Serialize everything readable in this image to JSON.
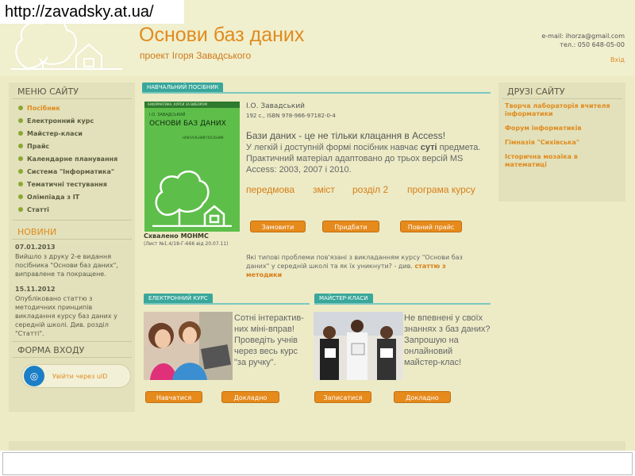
{
  "url": "http://zavadsky.at.ua/",
  "header": {
    "title": "Основи баз даних",
    "subtitle": "проект Ігоря Завадського",
    "email": "e-mail: ihorza@gmail.com",
    "phone": "тел.: 050 648-05-00",
    "login": "Вхід"
  },
  "sidebar": {
    "menu_title": "МЕНЮ САЙТУ",
    "items": [
      {
        "label": "Посібник"
      },
      {
        "label": "Електронний курс"
      },
      {
        "label": "Майстер-класи"
      },
      {
        "label": "Прайс"
      },
      {
        "label": "Календарне планування"
      },
      {
        "label": "Система \"Інформатика\""
      },
      {
        "label": "Тематичні тестування"
      },
      {
        "label": "Олімпіада з ІТ"
      },
      {
        "label": "Статті"
      }
    ],
    "news_title": "НОВИНИ",
    "news": [
      {
        "date": "07.01.2013",
        "text": "Вийшло з друку 2-е видання посібника \"Основи баз даних\", виправлене та покращене."
      },
      {
        "date": "15.11.2012",
        "text": "Опубліковано статтю з методичних принципів викладання курсу баз даних у середній школі. Див. розділ \"Статті\"."
      }
    ],
    "login_title": "ФОРМА ВХОДУ",
    "uid_label": "Увійти через uID"
  },
  "main": {
    "tab_book": "НАВЧАЛЬНИЙ ПОСІБНИК",
    "book": {
      "series": "ІНФОРМАТИКА. КУРСИ ЗА ВИБОРОМ",
      "author_short": "І.О. ЗАВАДСЬКИЙ",
      "title": "ОСНОВИ БАЗ ДАНИХ",
      "kind": "НАВЧАЛЬНИЙ ПОСІБНИК"
    },
    "approved": "Схвалено МОНМС",
    "approved_sub": "(Лист №1.4/18-Г-666 від 20.07.11)",
    "author": "І.О. Завадський",
    "isbn": "192 с., ISBN 978-966-97182-0-4",
    "heading": "Бази даних - це не тільки клацання в Access!",
    "desc_before": "У легкій і доступній формі посібник навчає ",
    "desc_bold": "суті",
    "desc_after": " предмета. Практичний матеріал адаптовано до трьох версій MS Access: 2003, 2007 і 2010.",
    "links": [
      "передмова",
      "зміст",
      "розділ 2",
      "програма курсу"
    ],
    "buttons": [
      "Замовити",
      "Придбати",
      "Повний прайс"
    ],
    "problems_text": "Які типові проблеми пов'язані з викладанням курсу \"Основи баз даних\" у середній школі та як їх уникнути? - див. ",
    "problems_link": "статтю з методики",
    "tab_ecourse": "ЕЛЕКТРОННИЙ КУРС",
    "ecourse_text": "Сотні інтерактив-них міні-вправ! Проведіть учнів через весь курс \"за ручку\".",
    "ecourse_buttons": [
      "Навчатися",
      "Докладно"
    ],
    "tab_master": "МАЙСТЕР-КЛАСИ",
    "master_text": "Не впевнені у своїх знаннях з баз даних? Запрошую на онлайновий майстер-клас!",
    "master_buttons": [
      "Записатися",
      "Докладно"
    ]
  },
  "right": {
    "title": "ДРУЗІ САЙТУ",
    "items": [
      {
        "label": "Творча лабораторія вчителя інформатики"
      },
      {
        "label": "Форум інформатиків"
      },
      {
        "label": "Гімназія \"Сихівська\""
      },
      {
        "label": "Історична мозаїка в математиці"
      }
    ]
  }
}
